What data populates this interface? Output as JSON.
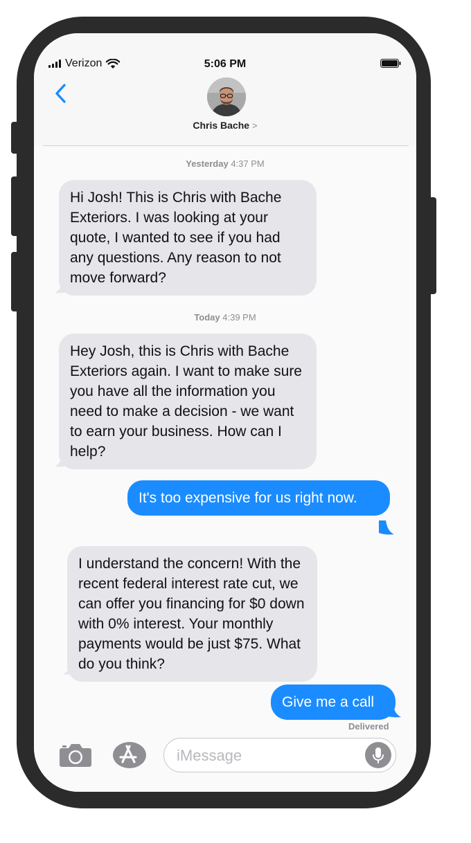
{
  "status_bar": {
    "carrier": "Verizon",
    "time": "5:06 PM"
  },
  "header": {
    "contact_name": "Chris Bache",
    "contact_chevron": ">"
  },
  "thread": [
    {
      "type": "timestamp",
      "day": "Yesterday",
      "time": "4:37 PM"
    },
    {
      "type": "incoming",
      "text": "Hi Josh! This is Chris with Bache Exteriors. I was looking at your quote, I wanted to see if you had any questions. Any reason to not move forward?"
    },
    {
      "type": "timestamp",
      "day": "Today",
      "time": "4:39 PM"
    },
    {
      "type": "incoming",
      "text": "Hey Josh, this is Chris with Bache Exteriors again. I want to make sure you have all the information you need to make a decision - we want to earn your business. How can I help?"
    },
    {
      "type": "outgoing",
      "text": "It's too expensive for us right now."
    },
    {
      "type": "incoming",
      "text": "I understand the concern! With the recent federal interest rate cut, we can offer you financing for $0 down with 0% interest. Your monthly payments would be just $75. What do you think?"
    },
    {
      "type": "outgoing",
      "text": "Give me a call"
    }
  ],
  "delivery_status": "Delivered",
  "composer": {
    "placeholder": "iMessage"
  },
  "colors": {
    "accent": "#1a8cff",
    "incoming_bubble": "#e5e5ea",
    "frame": "#2b2b2b"
  },
  "icons": {
    "back": "chevron-left-icon",
    "camera": "camera-icon",
    "apps": "app-store-icon",
    "mic": "microphone-icon"
  }
}
